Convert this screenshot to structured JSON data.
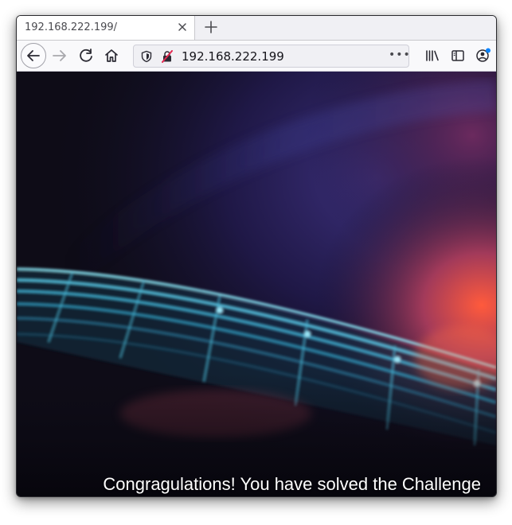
{
  "browser": {
    "tab": {
      "title": "192.168.222.199/",
      "close_icon": "close-icon"
    },
    "new_tab_icon": "plus-icon",
    "toolbar": {
      "back_icon": "arrow-left-icon",
      "forward_icon": "arrow-right-icon",
      "reload_icon": "reload-icon",
      "home_icon": "home-icon",
      "shield_icon": "tracking-protection-shield-icon",
      "insecure_icon": "insecure-lock-icon",
      "url": "192.168.222.199",
      "page_actions_label": "•••",
      "library_icon": "library-icon",
      "sidebar_icon": "sidebar-icon",
      "account_icon": "account-icon",
      "accent_color": "#0a84ff"
    }
  },
  "page": {
    "message": "Congragulations! You have solved the Challenge",
    "background": {
      "description_colors": [
        "#0d0b15",
        "#2a1e5c",
        "#3fa8c8",
        "#e0443a"
      ]
    }
  }
}
